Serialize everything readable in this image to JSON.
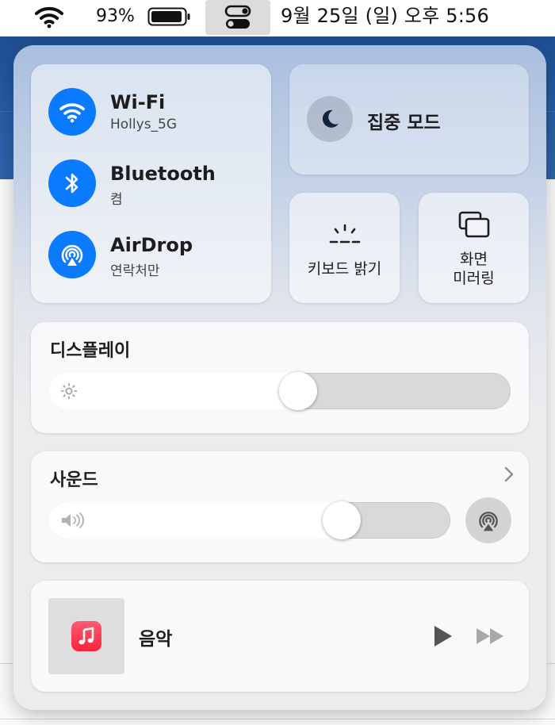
{
  "menubar": {
    "battery_percent": "93%",
    "clock": "9월 25일 (일) 오후  5:56",
    "icons": [
      "wifi-icon",
      "battery-icon",
      "control-center-icon"
    ]
  },
  "network": {
    "wifi": {
      "title": "Wi-Fi",
      "subtitle": "Hollys_5G",
      "icon": "wifi-icon",
      "active": true
    },
    "bluetooth": {
      "title": "Bluetooth",
      "subtitle": "켬",
      "icon": "bluetooth-icon",
      "active": true
    },
    "airdrop": {
      "title": "AirDrop",
      "subtitle": "연락처만",
      "icon": "airdrop-icon",
      "active": true
    }
  },
  "focus": {
    "label": "집중 모드",
    "icon": "moon-icon"
  },
  "keyboard_brightness": {
    "label": "키보드 밝기",
    "icon": "keyboard-brightness-icon"
  },
  "screen_mirroring": {
    "label_line1": "화면",
    "label_line2": "미러링",
    "icon": "screen-mirroring-icon"
  },
  "display": {
    "title": "디스플레이",
    "brightness_fraction": 0.54,
    "icon": "sun-icon"
  },
  "sound": {
    "title": "사운드",
    "volume_fraction": 0.73,
    "icon": "speaker-icon"
  },
  "now_playing": {
    "title": "음악",
    "icon": "music-app-icon"
  },
  "colors": {
    "accent": "#0a7aff",
    "music": "#fa233b"
  }
}
